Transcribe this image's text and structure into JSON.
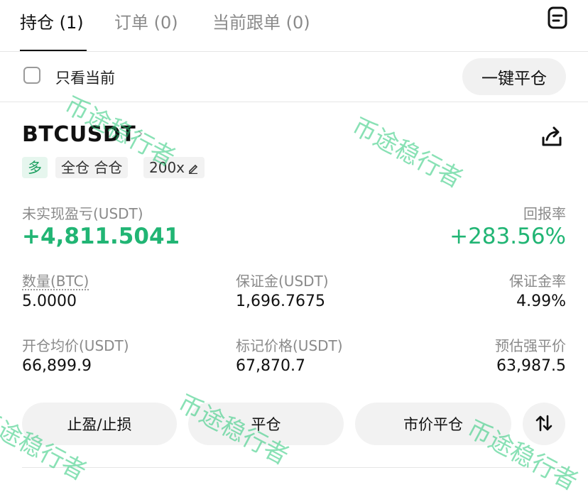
{
  "tabs": [
    {
      "label": "持仓 (1)"
    },
    {
      "label": "订单 (0)"
    },
    {
      "label": "当前跟单 (0)"
    }
  ],
  "filter": {
    "show_current_label": "只看当前",
    "close_all_label": "一键平仓"
  },
  "position": {
    "symbol": "BTCUSDT",
    "side_tag": "多",
    "margin_mode_tag": "全仓 合仓",
    "leverage_tag": "200x",
    "pnl_label": "未实现盈亏(USDT)",
    "pnl_value": "+4,811.5041",
    "roe_label": "回报率",
    "roe_value": "+283.56%",
    "qty_label": "数量(BTC)",
    "qty_value": "5.0000",
    "margin_label": "保证金(USDT)",
    "margin_value": "1,696.7675",
    "margin_rate_label": "保证金率",
    "margin_rate_value": "4.99%",
    "entry_label": "开仓均价(USDT)",
    "entry_value": "66,899.9",
    "mark_label": "标记价格(USDT)",
    "mark_value": "67,870.7",
    "liq_label": "预估强平价",
    "liq_value": "63,987.5"
  },
  "actions": {
    "tp_sl_label": "止盈/止损",
    "close_label": "平仓",
    "market_close_label": "市价平仓"
  },
  "watermark": "币途稳行者",
  "colors": {
    "profit_green": "#21b574",
    "long_tag_bg": "#e6f6ee"
  },
  "icons": [
    "document-icon",
    "chevron-right-icon",
    "share-icon",
    "edit-pencil-icon",
    "swap-arrows-icon"
  ]
}
